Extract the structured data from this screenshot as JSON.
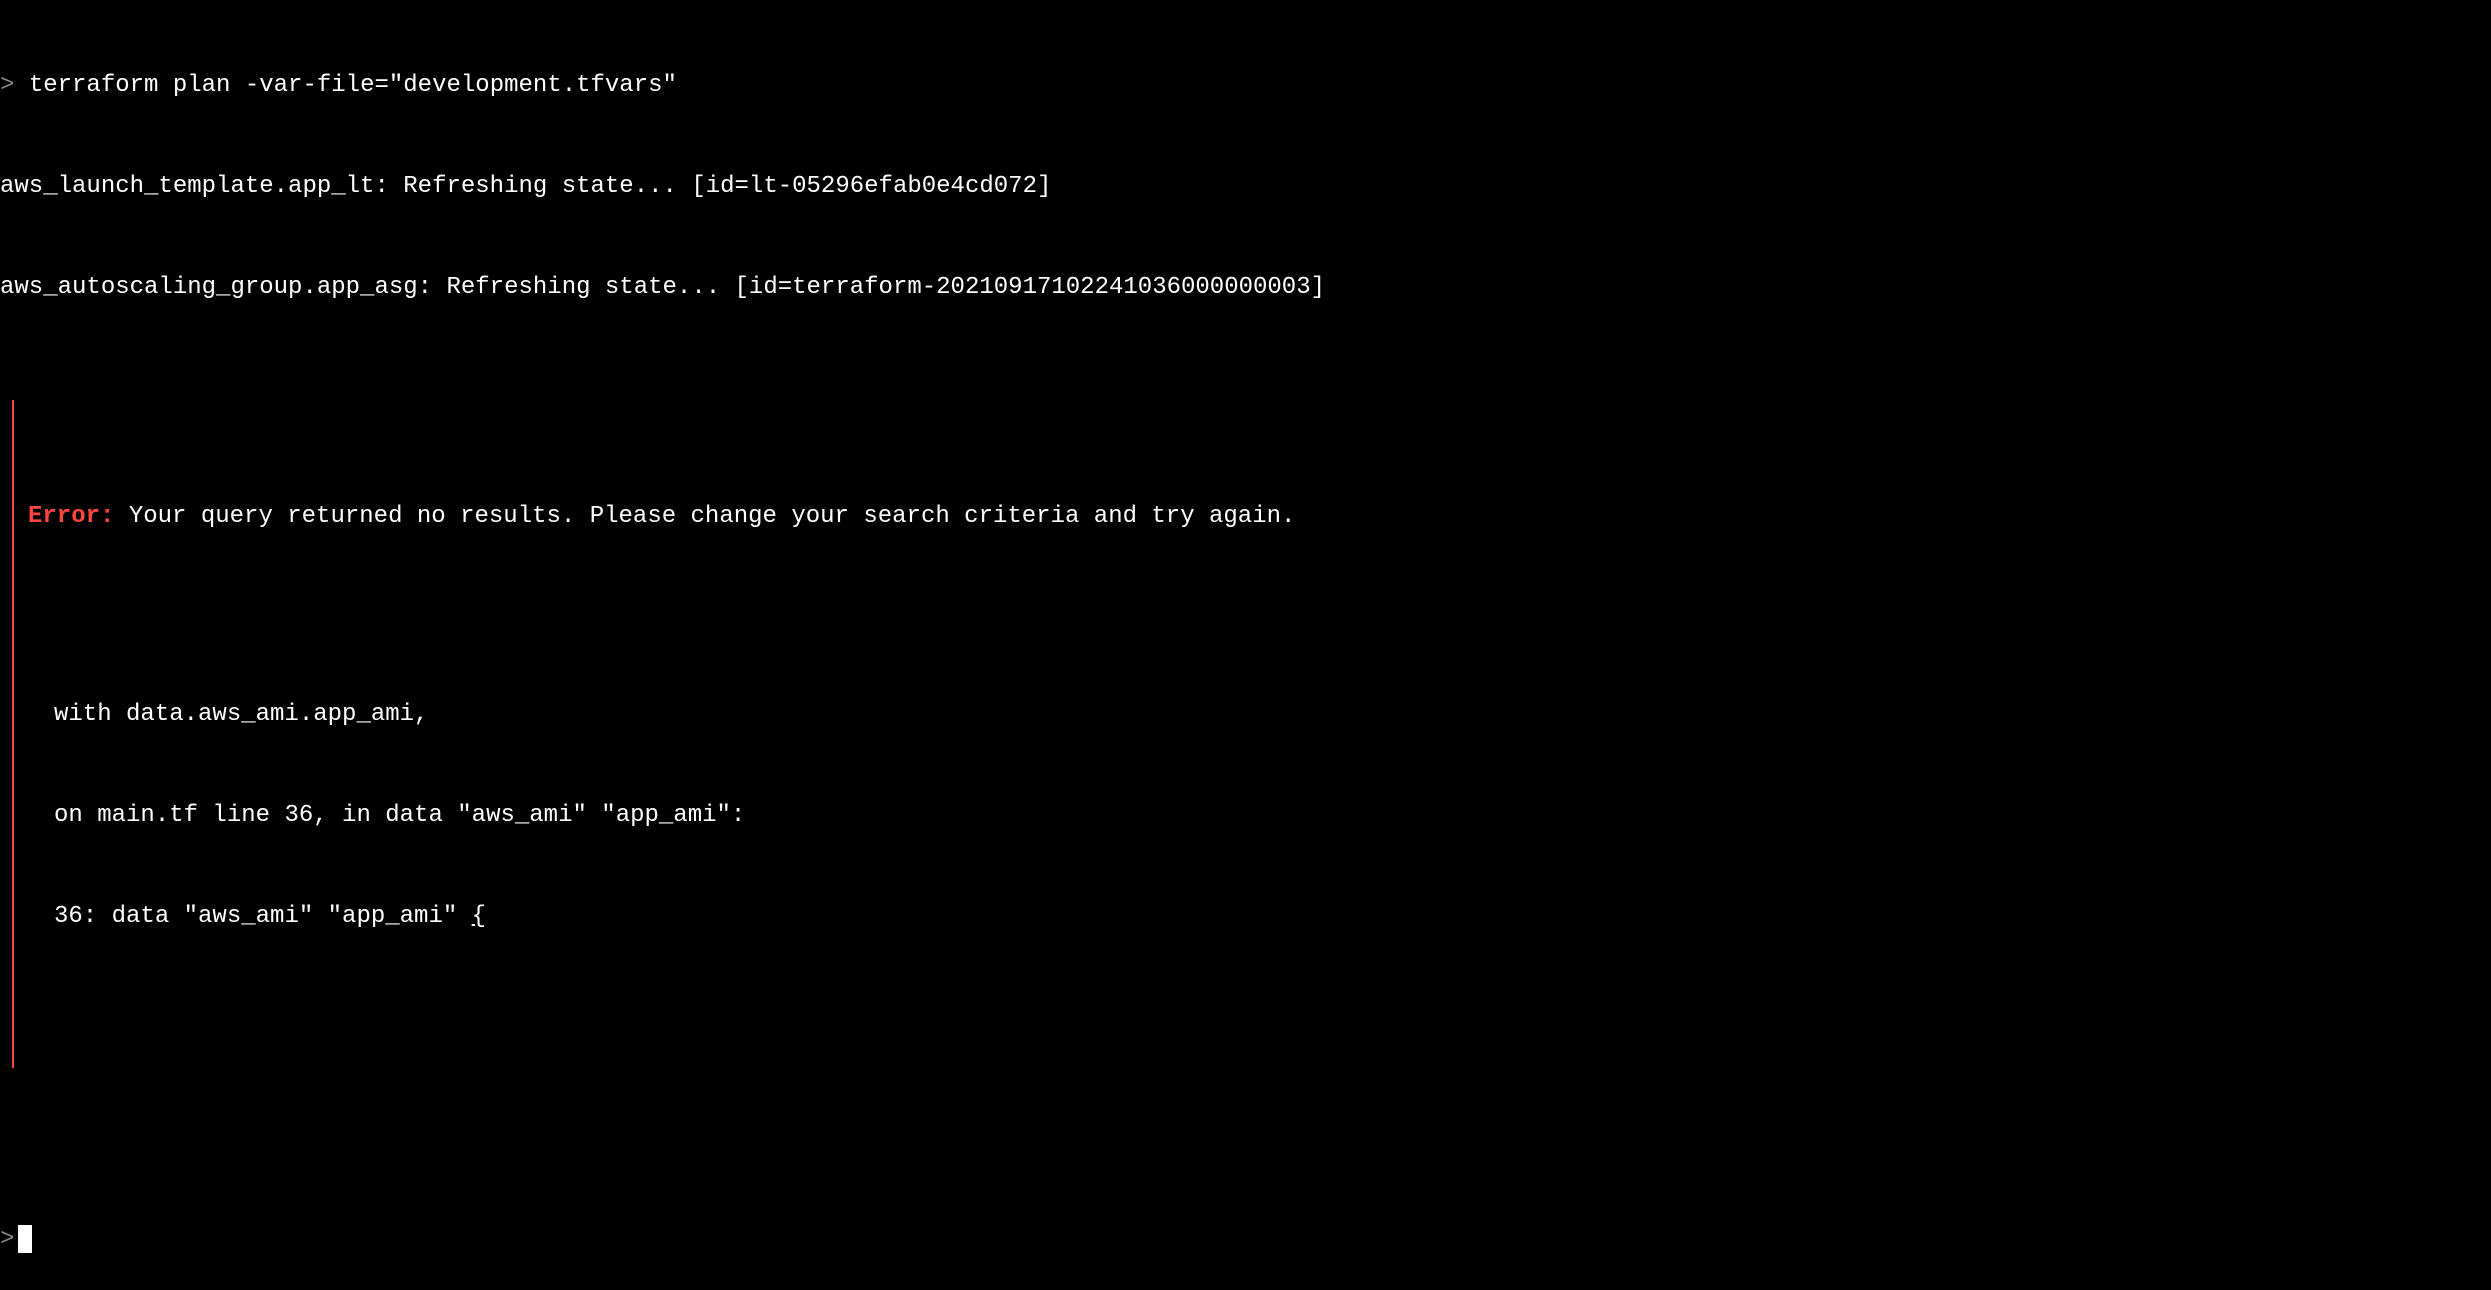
{
  "prompt": {
    "char": ">",
    "command": "terraform plan -var-file=\"development.tfvars\""
  },
  "refresh": {
    "line1": "aws_launch_template.app_lt: Refreshing state... [id=lt-05296efab0e4cd072]",
    "line2": "aws_autoscaling_group.app_asg: Refreshing state... [id=terraform-20210917102241036000000003]"
  },
  "error": {
    "label": "Error:",
    "message": "Your query returned no results. Please change your search criteria and try again.",
    "context_line1": "with data.aws_ami.app_ami,",
    "context_line2": "on main.tf line 36, in data \"aws_ami\" \"app_ami\":",
    "context_line3_prefix": "36: data \"aws_ami\" \"app_ami\" ",
    "context_line3_brace": "{"
  },
  "final_prompt": ">"
}
